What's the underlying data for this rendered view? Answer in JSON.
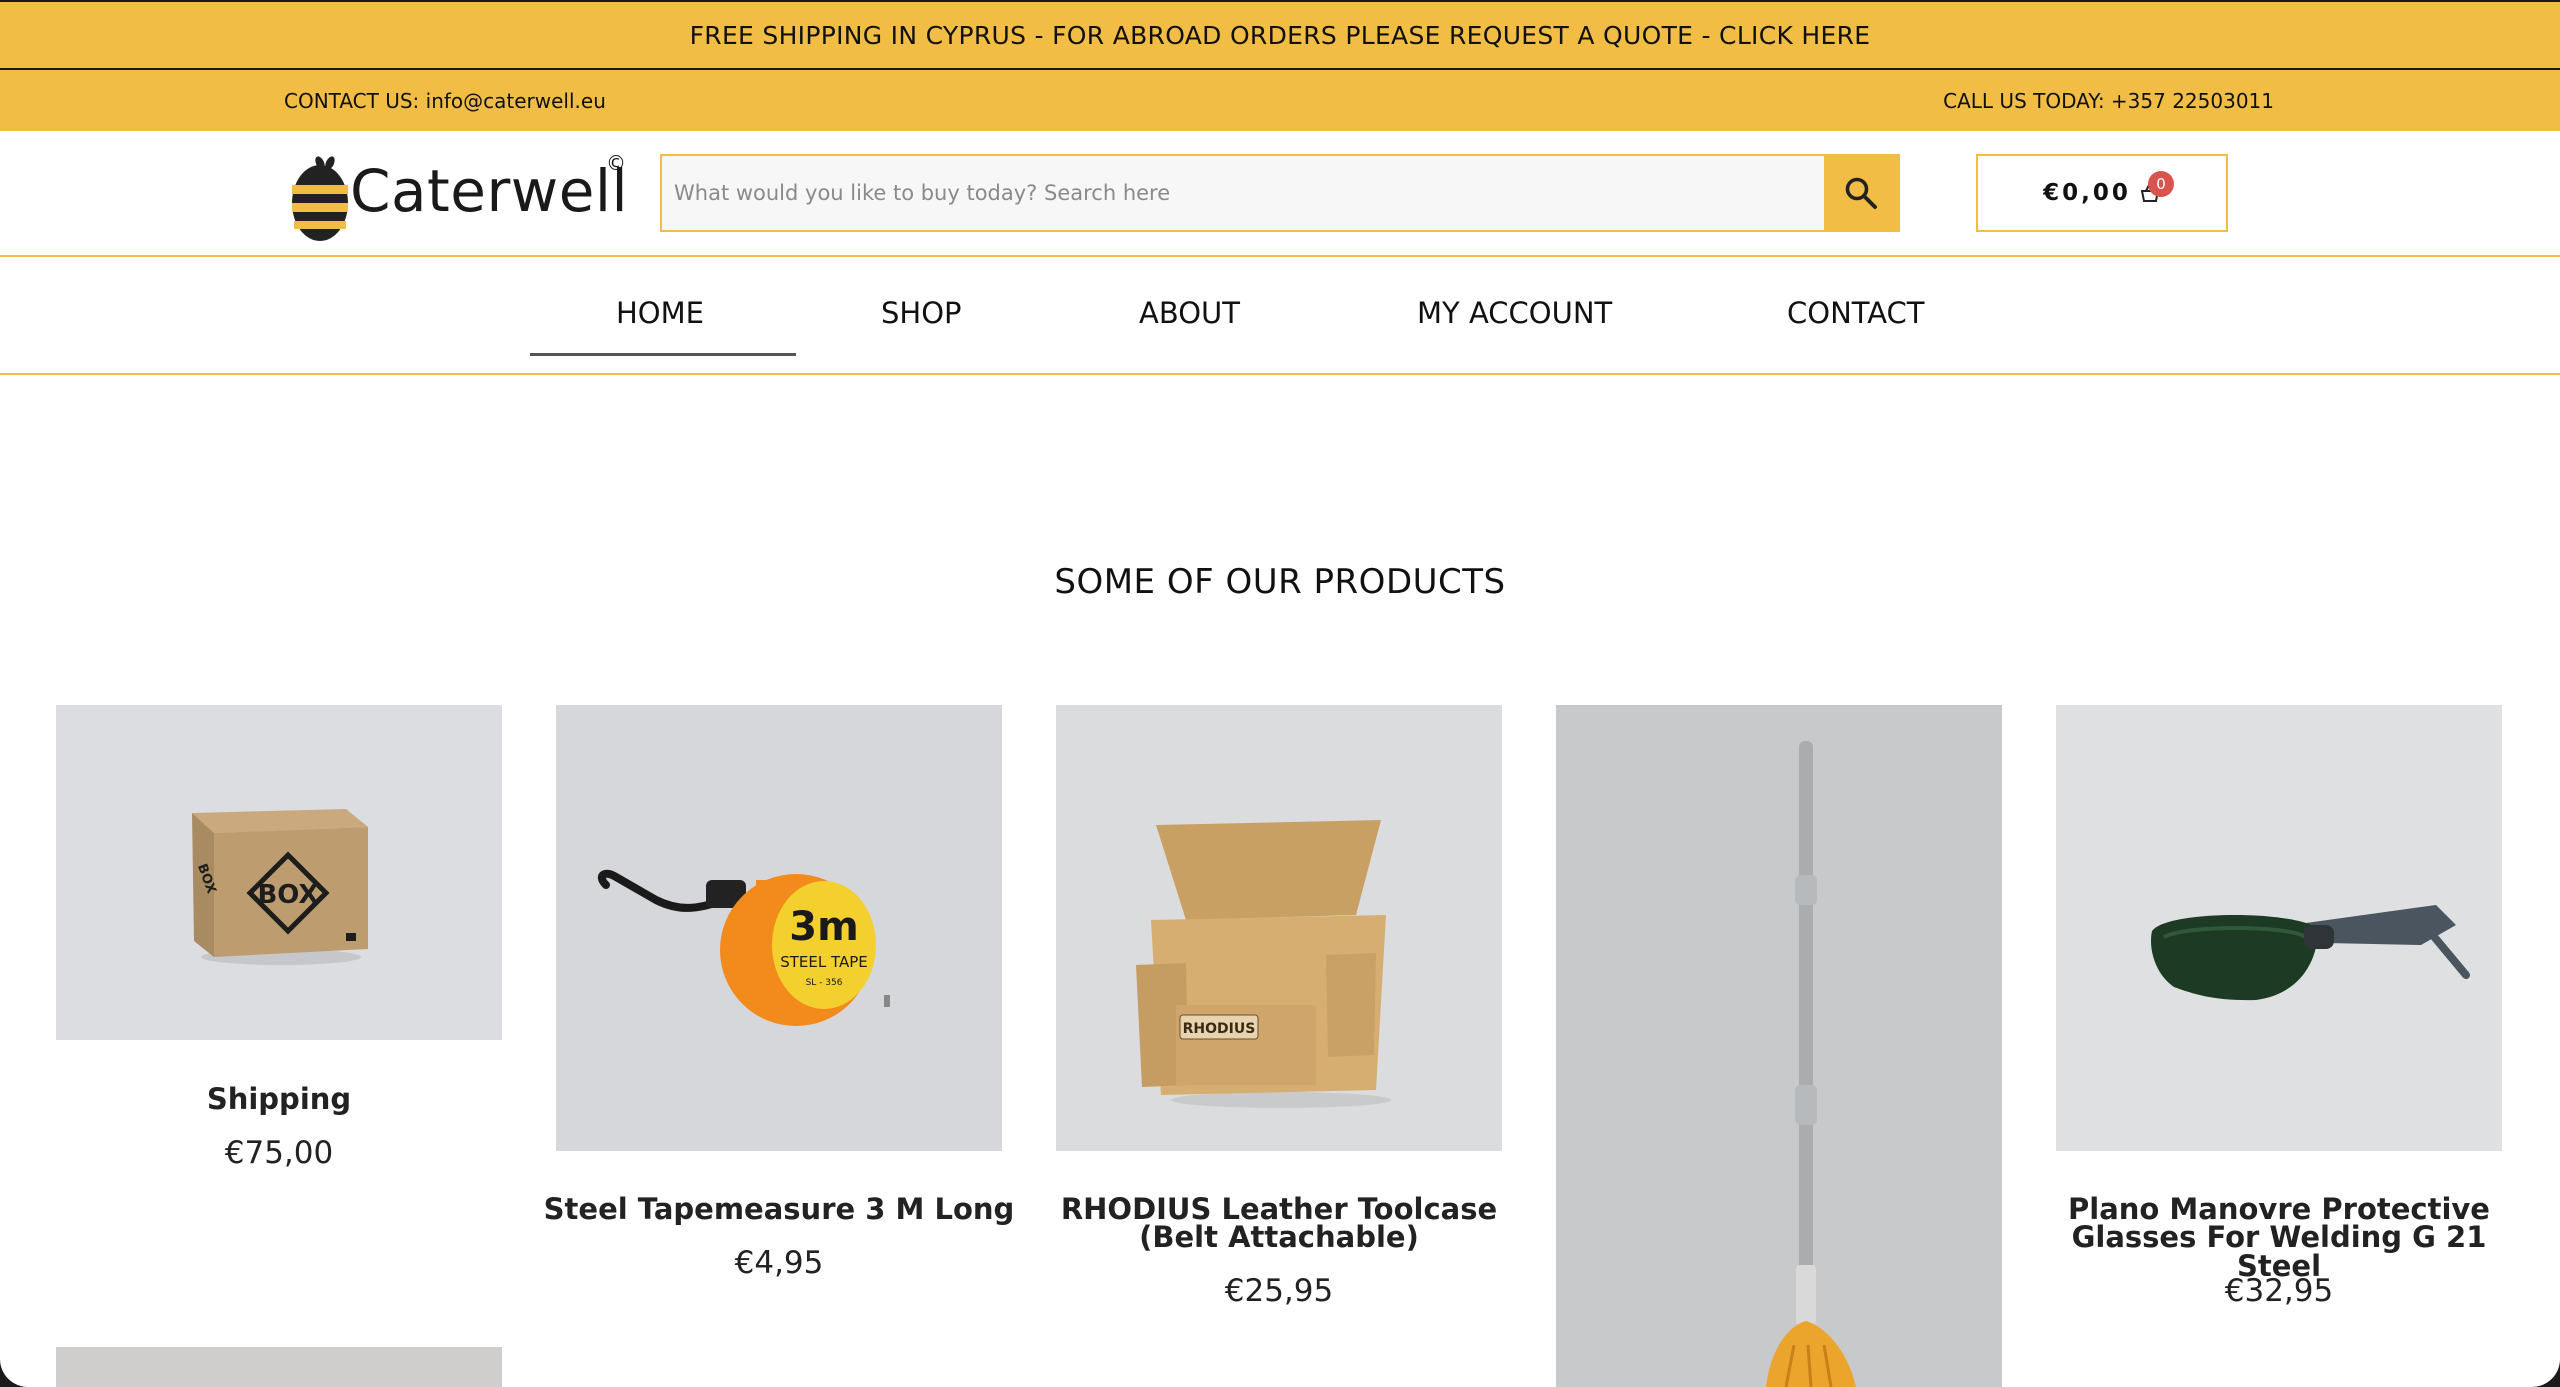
{
  "promo": {
    "text": "FREE SHIPPING IN CYPRUS - FOR ABROAD ORDERS PLEASE REQUEST A QUOTE - CLICK HERE"
  },
  "contact": {
    "email": "CONTACT US: info@caterwell.eu",
    "phone": "CALL US TODAY: +357 22503011"
  },
  "brand": {
    "name": "Caterwell",
    "mark": "©"
  },
  "search": {
    "placeholder": "What would you like to buy today? Search here",
    "icon": "search-icon"
  },
  "cart": {
    "amount": "€0,00",
    "count": "0",
    "icon": "basket-icon"
  },
  "nav": {
    "items": [
      {
        "label": "HOME",
        "active": true
      },
      {
        "label": "SHOP"
      },
      {
        "label": "ABOUT"
      },
      {
        "label": "MY ACCOUNT"
      },
      {
        "label": "CONTACT"
      }
    ]
  },
  "products": {
    "title": "SOME OF OUR PRODUCTS",
    "items": [
      {
        "name": "Shipping",
        "price": "€75,00"
      },
      {
        "name": "Steel Tapemeasure 3 M Long",
        "price": "€4,95",
        "image_text": {
          "big": "3m",
          "line1": "STEEL TAPE",
          "line2": "SL - 356"
        }
      },
      {
        "name_line1": "RHODIUS Leather Toolcase",
        "name_line2": "(Belt Attachable)",
        "price": "€25,95",
        "image_text": "RHODIUS"
      },
      {
        "name": "",
        "price": ""
      },
      {
        "name_line1": "Plano Manovre Protective",
        "name_line2": "Glasses For Welding G 21 Steel",
        "price": "€32,95"
      }
    ]
  },
  "colors": {
    "accent": "#f1bd45",
    "badge": "#d9534f"
  }
}
